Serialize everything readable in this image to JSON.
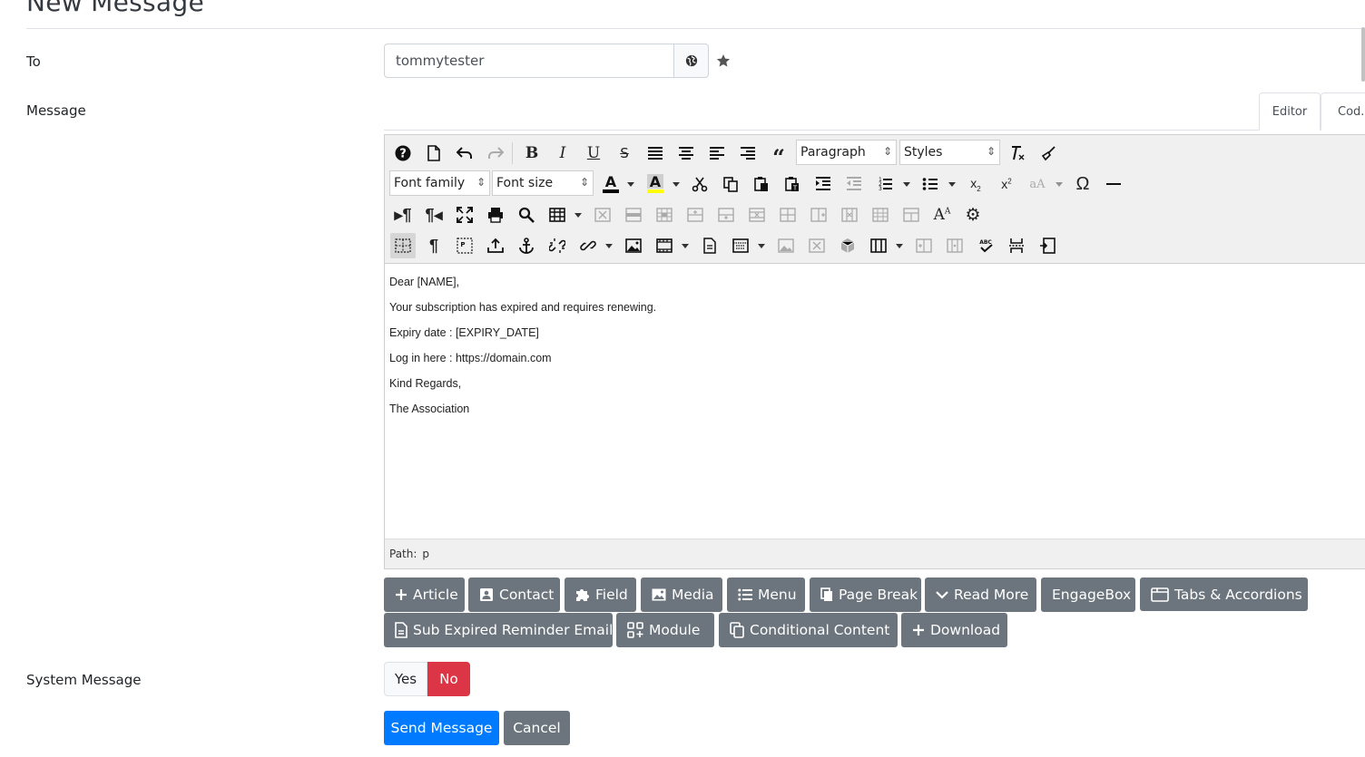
{
  "page": {
    "title": "New Message"
  },
  "form": {
    "to_label": "To",
    "to_value": "tommytester",
    "message_label": "Message",
    "system_message_label": "System Message"
  },
  "tabs": {
    "editor": "Editor",
    "code": "Cod..."
  },
  "editor": {
    "block_format": "Paragraph",
    "styles": "Styles",
    "font_family": "Font family",
    "font_size": "Font size",
    "text_color": "#000000",
    "highlight_color": "#ffff00",
    "content": [
      "Dear [NAME],",
      "Your subscription has expired and requires renewing.",
      "Expiry date : [EXPIRY_DATE]",
      "Log in here : https://domain.com",
      "Kind Regards,",
      "The Association"
    ],
    "path_label": "Path:",
    "path_value": "p"
  },
  "insert_buttons": [
    {
      "label": "Article",
      "icon": "plus-icon"
    },
    {
      "label": "Contact",
      "icon": "contact-card-icon"
    },
    {
      "label": "Field",
      "icon": "puzzle-icon"
    },
    {
      "label": "Media",
      "icon": "image-icon"
    },
    {
      "label": "Menu",
      "icon": "list-icon"
    },
    {
      "label": "Page Break",
      "icon": "copy-icon"
    },
    {
      "label": "Read More",
      "icon": "chevron-down-icon"
    },
    {
      "label": "EngageBox",
      "icon": ""
    },
    {
      "label": "Tabs & Accordions",
      "icon": "window-icon"
    },
    {
      "label": "Sub Expired Reminder Email",
      "icon": "file-icon"
    },
    {
      "label": "Module",
      "icon": "grid-icon"
    },
    {
      "label": "Conditional Content",
      "icon": "copy-icon"
    },
    {
      "label": "Download",
      "icon": "plus-icon"
    }
  ],
  "toggle": {
    "yes": "Yes",
    "no": "No",
    "selected": "No"
  },
  "actions": {
    "send": "Send Message",
    "cancel": "Cancel"
  },
  "colors": {
    "primary": "#007bff",
    "secondary": "#6c757d",
    "danger": "#dc3545"
  }
}
